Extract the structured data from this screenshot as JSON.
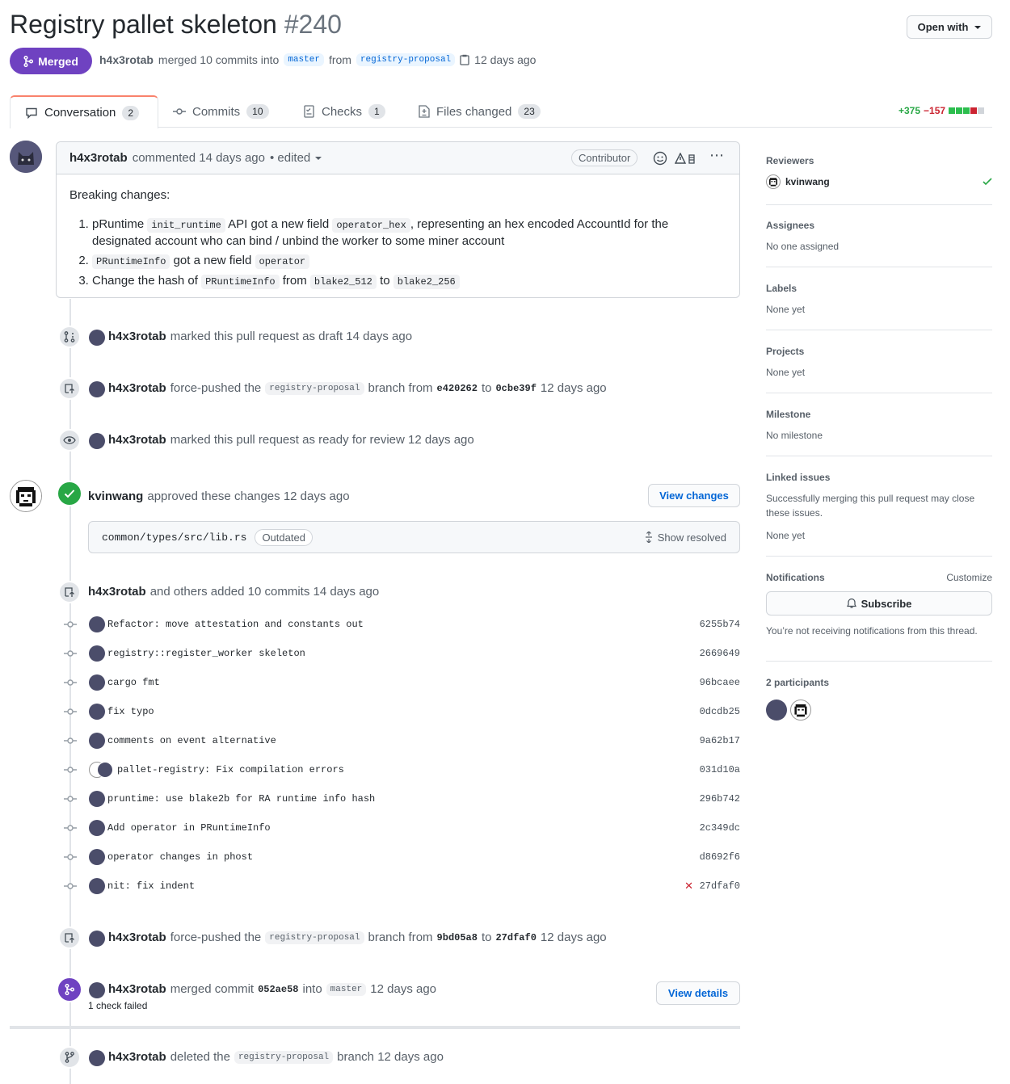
{
  "header": {
    "title": "Registry pallet skeleton",
    "number": "#240",
    "open_with": "Open with",
    "state": "Merged",
    "author": "h4x3rotab",
    "merged_text": "merged 10 commits into",
    "base_branch": "master",
    "from_text": "from",
    "head_branch": "registry-proposal",
    "time": "12 days ago"
  },
  "tabs": [
    {
      "label": "Conversation",
      "count": "2"
    },
    {
      "label": "Commits",
      "count": "10"
    },
    {
      "label": "Checks",
      "count": "1"
    },
    {
      "label": "Files changed",
      "count": "23"
    }
  ],
  "diffstat": {
    "additions": "+375",
    "deletions": "−157"
  },
  "comment": {
    "author": "h4x3rotab",
    "meta": "commented 14 days ago",
    "edited": "• edited",
    "badge": "Contributor",
    "intro": "Breaking changes:",
    "items": {
      "i1a": "pRuntime",
      "i1code1": "init_runtime",
      "i1b": "API got a new field",
      "i1code2": "operator_hex",
      "i1c": ", representing an hex encoded AccountId for the designated account who can bind / unbind the worker to some miner account",
      "i2code1": "PRuntimeInfo",
      "i2a": "got a new field",
      "i2code2": "operator",
      "i3a": "Change the hash of",
      "i3code1": "PRuntimeInfo",
      "i3b": "from",
      "i3code2": "blake2_512",
      "i3c": "to",
      "i3code3": "blake2_256"
    }
  },
  "events": {
    "draft": {
      "author": "h4x3rotab",
      "text": "marked this pull request as draft 14 days ago"
    },
    "push1": {
      "author": "h4x3rotab",
      "a": "force-pushed the",
      "branch": "registry-proposal",
      "b": "branch from",
      "from": "e420262",
      "to_word": "to",
      "to": "0cbe39f",
      "time": "12 days ago"
    },
    "ready": {
      "author": "h4x3rotab",
      "text": "marked this pull request as ready for review 12 days ago"
    },
    "review": {
      "author": "kvinwang",
      "text": "approved these changes 12 days ago",
      "button": "View changes",
      "file": "common/types/src/lib.rs",
      "outdated": "Outdated",
      "show_resolved": "Show resolved"
    },
    "commits_added": {
      "author": "h4x3rotab",
      "text": "and others added 10 commits 14 days ago"
    },
    "push2": {
      "author": "h4x3rotab",
      "a": "force-pushed the",
      "branch": "registry-proposal",
      "b": "branch from",
      "from": "9bd05a8",
      "to_word": "to",
      "to": "27dfaf0",
      "time": "12 days ago"
    },
    "merge": {
      "author": "h4x3rotab",
      "a": "merged commit",
      "sha": "052ae58",
      "b": "into",
      "branch": "master",
      "time": "12 days ago",
      "check": "1 check failed",
      "button": "View details"
    },
    "deleted": {
      "author": "h4x3rotab",
      "a": "deleted the",
      "branch": "registry-proposal",
      "b": "branch 12 days ago"
    }
  },
  "commits": [
    {
      "msg": "Refactor: move attestation and constants out",
      "sha": "6255b74"
    },
    {
      "msg": "registry::register_worker skeleton",
      "sha": "2669649"
    },
    {
      "msg": "cargo fmt",
      "sha": "96bcaee"
    },
    {
      "msg": "fix typo",
      "sha": "0dcdb25"
    },
    {
      "msg": "comments on event alternative",
      "sha": "9a62b17"
    },
    {
      "msg": "pallet-registry: Fix compilation errors",
      "sha": "031d10a"
    },
    {
      "msg": "pruntime: use blake2b for RA runtime info hash",
      "sha": "296b742"
    },
    {
      "msg": "Add operator in PRuntimeInfo",
      "sha": "2c349dc"
    },
    {
      "msg": "operator changes in phost",
      "sha": "d8692f6"
    },
    {
      "msg": "nit: fix indent",
      "sha": "27dfaf0"
    }
  ],
  "sidebar": {
    "reviewers_h": "Reviewers",
    "reviewer": "kvinwang",
    "assignees_h": "Assignees",
    "assignees_v": "No one assigned",
    "labels_h": "Labels",
    "labels_v": "None yet",
    "projects_h": "Projects",
    "projects_v": "None yet",
    "milestone_h": "Milestone",
    "milestone_v": "No milestone",
    "linked_h": "Linked issues",
    "linked_desc": "Successfully merging this pull request may close these issues.",
    "linked_v": "None yet",
    "notif_h": "Notifications",
    "customize": "Customize",
    "subscribe": "Subscribe",
    "notif_v": "You’re not receiving notifications from this thread.",
    "participants_h": "2 participants"
  },
  "colors": {
    "merged": "#6f42c1",
    "approved": "#28a745",
    "link": "#0366d6"
  }
}
